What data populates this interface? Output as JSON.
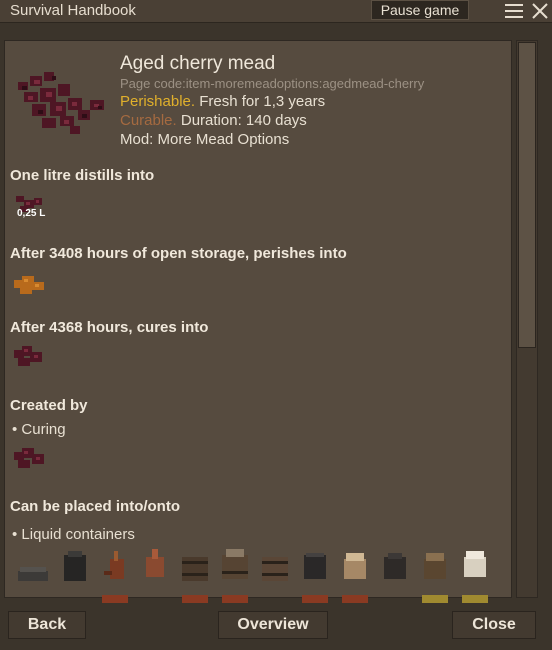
{
  "window": {
    "title": "Survival Handbook",
    "pause_label": "Pause game"
  },
  "item": {
    "name": "Aged cherry mead",
    "page_code": "Page code:item-moremeadoptions:agedmead-cherry",
    "perishable_label": "Perishable.",
    "perishable_text": " Fresh for 1,3 years",
    "curable_label": "Curable.",
    "curable_text": " Duration: 140 days",
    "mod": "Mod: More Mead Options"
  },
  "sections": {
    "distill_heading": "One litre distills into",
    "distill_amount": "0,25 L",
    "perish_heading": "After 3408 hours of open storage, perishes into",
    "cure_heading": "After 4368 hours, cures into",
    "created_heading": "Created by",
    "created_bullet": "• Curing",
    "placed_heading": "Can be placed into/onto",
    "placed_bullet": "• Liquid containers"
  },
  "footer": {
    "back": "Back",
    "overview": "Overview",
    "close": "Close"
  },
  "colors": {
    "perishable": "#e0b02c",
    "curable": "#a56a40",
    "mead": "#5a1b2a",
    "rot": "#b86a1c"
  }
}
